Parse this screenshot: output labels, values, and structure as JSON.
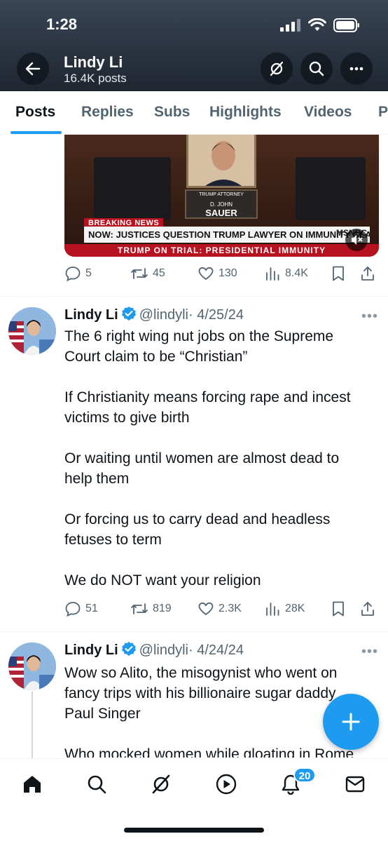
{
  "status_bar": {
    "time": "1:28"
  },
  "header": {
    "name": "Lindy Li",
    "subtitle": "16.4K posts",
    "back_icon": "arrow-left-icon",
    "grok_icon": "grok-icon",
    "search_icon": "search-icon",
    "more_icon": "more-horizontal-icon"
  },
  "tabs": [
    {
      "label": "Posts",
      "active": true
    },
    {
      "label": "Replies"
    },
    {
      "label": "Subs"
    },
    {
      "label": "Highlights"
    },
    {
      "label": "Videos"
    },
    {
      "label": "P"
    }
  ],
  "media": {
    "plate_title": "TRUMP ATTORNEY",
    "plate_first": "D. JOHN",
    "plate_last": "SAUER",
    "breaking": "BREAKING NEWS",
    "headline": "NOW: JUSTICES QUESTION TRUMP LAWYER ON IMMUNITY CLAIM",
    "network": "MSNBC",
    "live": "LIVE",
    "ticker": "TRUMP ON TRIAL: PRESIDENTIAL IMMUNITY"
  },
  "posts": [
    {
      "stats": {
        "replies": "5",
        "reposts": "45",
        "likes": "130",
        "views": "8.4K"
      }
    },
    {
      "name": "Lindy Li",
      "handle": "@lindyli",
      "date": "· 4/25/24",
      "lines": [
        "The 6 right wing nut jobs on the Supreme",
        "Court claim to be “Christian”",
        "",
        "If Christianity means forcing rape and incest",
        "victims to give birth",
        "",
        "Or waiting until women are almost dead to",
        "help them",
        "",
        "Or forcing us to carry dead and headless",
        "fetuses to term",
        "",
        "We do NOT want your religion"
      ],
      "stats": {
        "replies": "51",
        "reposts": "819",
        "likes": "2.3K",
        "views": "28K"
      }
    },
    {
      "name": "Lindy Li",
      "handle": "@lindyli",
      "date": "· 4/24/24",
      "lines": [
        "Wow so Alito, the misogynist who went on",
        "fancy trips with his billionaire sugar daddy",
        "Paul Singer",
        "",
        "Who mocked women while gloating in Rome"
      ]
    }
  ],
  "more_label": "•••",
  "bottom_nav": {
    "items": [
      "home-icon",
      "search-icon",
      "grok-icon",
      "video-play-icon",
      "notifications-bell-icon",
      "messages-envelope-icon"
    ],
    "notification_count": "20"
  },
  "colors": {
    "accent": "#1d9bf0",
    "text": "#0f1419",
    "secondary": "#536471"
  }
}
